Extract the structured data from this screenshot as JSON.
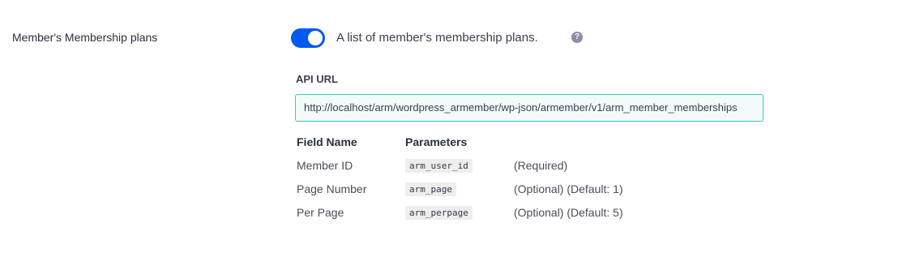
{
  "setting": {
    "label": "Member's Membership plans",
    "toggle_on": true,
    "description": "A list of member's membership plans.",
    "help_glyph": "?"
  },
  "api": {
    "label": "API URL",
    "url": "http://localhost/arm/wordpress_armember/wp-json/armember/v1/arm_member_memberships"
  },
  "params": {
    "headers": {
      "field": "Field Name",
      "param": "Parameters"
    },
    "rows": [
      {
        "field": "Member ID",
        "param": "arm_user_id",
        "note": "(Required)"
      },
      {
        "field": "Page Number",
        "param": "arm_page",
        "note": "(Optional) (Default: 1)"
      },
      {
        "field": "Per Page",
        "param": "arm_perpage",
        "note": "(Optional) (Default: 5)"
      }
    ]
  },
  "colors": {
    "toggle_on": "#005aee",
    "input_border": "#2ecfb5",
    "input_bg": "#f2fbf9",
    "help_icon": "#8a8ea6"
  },
  "icons": {
    "help": "question-circle-icon"
  }
}
